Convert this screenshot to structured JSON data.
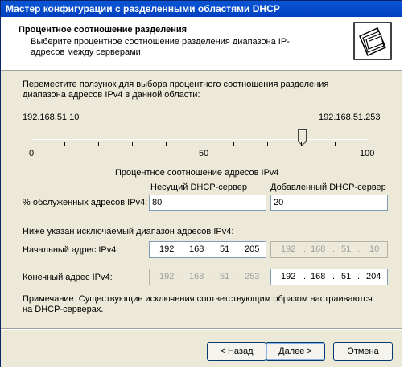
{
  "window": {
    "title": "Мастер конфигурации с разделенными областями DHCP"
  },
  "header": {
    "title": "Процентное соотношение разделения",
    "description": "Выберите процентное соотношение разделения диапазона IP-адресов между серверами.",
    "icon": "folders-icon"
  },
  "slider": {
    "instruction": "Переместите ползунок для выбора процентного соотношения разделения диапазона адресов IPv4 в данной области:",
    "left_address": "192.168.51.10",
    "right_address": "192.168.51.253",
    "scale_min": "0",
    "scale_mid": "50",
    "scale_max": "100",
    "value_percent": 80
  },
  "ratio": {
    "heading": "Процентное соотношение адресов IPv4",
    "col_host": "Несущий DHCP-сервер",
    "col_added": "Добавленный DHCP-сервер",
    "row_label": "% обслуженных адресов IPv4:",
    "host_value": "80",
    "added_value": "20"
  },
  "exclusion": {
    "heading": "Ниже указан исключаемый диапазон адресов IPv4:",
    "start_label": "Начальный адрес IPv4:",
    "end_label": "Конечный адрес IPv4:",
    "start_host": [
      "192",
      "168",
      "51",
      "205"
    ],
    "start_added": [
      "192",
      "168",
      "51",
      "10"
    ],
    "end_host": [
      "192",
      "168",
      "51",
      "253"
    ],
    "end_added": [
      "192",
      "168",
      "51",
      "204"
    ]
  },
  "note": "Примечание. Существующие исключения соответствующим образом настраиваются на DHCP-серверах.",
  "buttons": {
    "back": "< Назад",
    "next": "Далее >",
    "cancel": "Отмена"
  }
}
